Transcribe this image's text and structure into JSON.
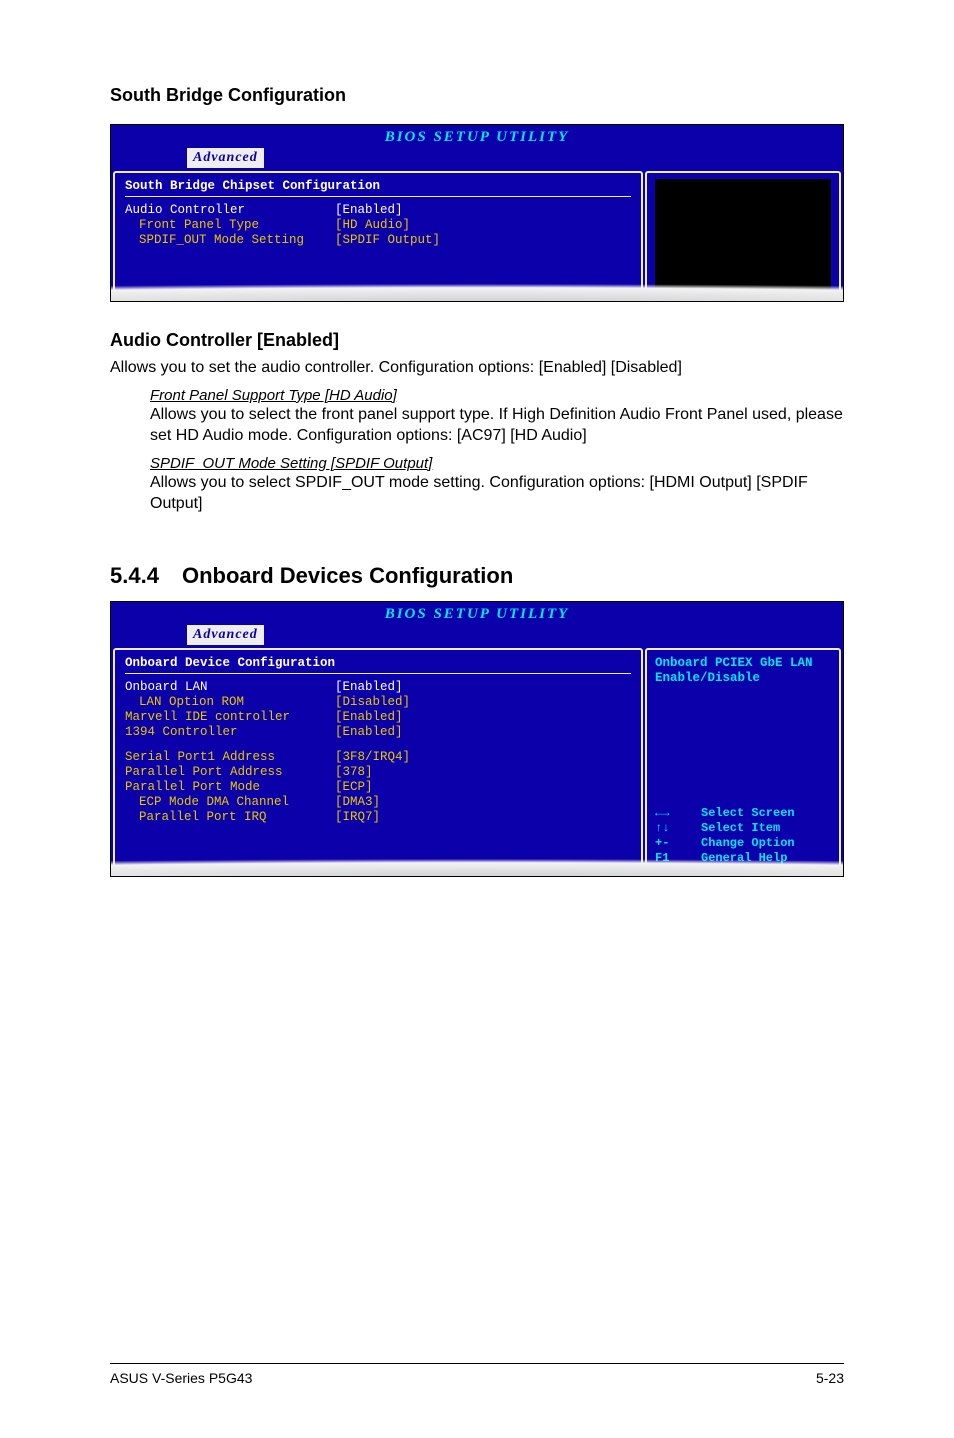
{
  "headings": {
    "south_bridge": "South Bridge Configuration",
    "audio_controller": "Audio Controller [Enabled]",
    "onboard_section_num": "5.4.4",
    "onboard_section_title": "Onboard Devices Configuration"
  },
  "paragraphs": {
    "audio_controller_desc": "Allows you to set the audio controller. Configuration options: [Enabled] [Disabled]",
    "front_panel_label": "Front Panel Support Type [HD Audio]",
    "front_panel_desc": "Allows you to select the front panel support type. If High Definition Audio Front Panel used, please set HD Audio mode. Configuration options: [AC97] [HD Audio]",
    "spdif_label": "SPDIF_OUT Mode Setting [SPDIF Output]",
    "spdif_desc": "Allows you to select SPDIF_OUT mode setting. Configuration options: [HDMI Output] [SPDIF Output]"
  },
  "bios_common": {
    "title": "BIOS SETUP UTILITY",
    "tab": "Advanced"
  },
  "bios1": {
    "section": "South Bridge Chipset Configuration",
    "rows": [
      {
        "name": "Audio Controller",
        "val": "[Enabled]",
        "hl": true,
        "indent": 0
      },
      {
        "name": "Front Panel Type",
        "val": "[HD Audio]",
        "hl": false,
        "indent": 1
      },
      {
        "name": "SPDIF_OUT Mode Setting",
        "val": "[SPDIF Output]",
        "hl": false,
        "indent": 1
      }
    ]
  },
  "bios2": {
    "section": "Onboard Device Configuration",
    "help1": "Onboard PCIEX GbE LAN",
    "help2": "Enable/Disable",
    "rows_a": [
      {
        "name": "Onboard LAN",
        "val": "[Enabled]",
        "hl": true,
        "indent": 0
      },
      {
        "name": "LAN Option ROM",
        "val": "[Disabled]",
        "hl": false,
        "indent": 1
      },
      {
        "name": "Marvell IDE controller",
        "val": "[Enabled]",
        "hl": false,
        "indent": 0
      },
      {
        "name": "1394 Controller",
        "val": "[Enabled]",
        "hl": false,
        "indent": 0
      }
    ],
    "rows_b": [
      {
        "name": "Serial Port1 Address",
        "val": "[3F8/IRQ4]",
        "hl": false,
        "indent": 0
      },
      {
        "name": "Parallel Port Address",
        "val": "[378]",
        "hl": false,
        "indent": 0
      },
      {
        "name": "Parallel Port Mode",
        "val": "[ECP]",
        "hl": false,
        "indent": 0
      },
      {
        "name": "ECP Mode DMA Channel",
        "val": "[DMA3]",
        "hl": false,
        "indent": 1
      },
      {
        "name": "Parallel Port IRQ",
        "val": "[IRQ7]",
        "hl": false,
        "indent": 1
      }
    ],
    "nav": [
      {
        "key": "←→",
        "label": "Select Screen"
      },
      {
        "key": "↑↓",
        "label": "Select Item"
      },
      {
        "key": "+-",
        "label": "Change Option"
      },
      {
        "key": "F1",
        "label": "General Help"
      }
    ]
  },
  "footer": {
    "left": "ASUS V-Series P5G43",
    "right": "5-23"
  }
}
